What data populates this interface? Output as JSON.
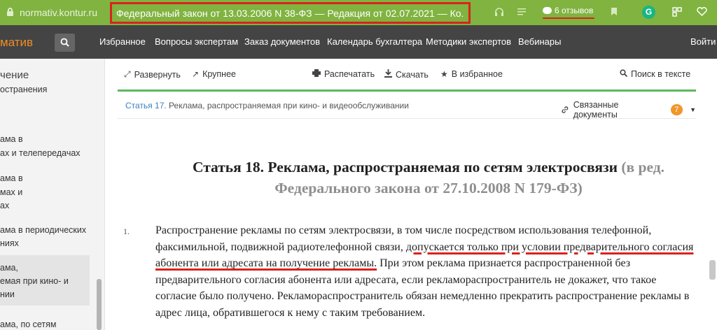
{
  "browser": {
    "url": "normativ.kontur.ru",
    "tab_title": "Федеральный закон от 13.03.2006 N 38-ФЗ — Редакция от 02.07.2021 — Ко...",
    "reviews_label": "6 отзывов",
    "icons": [
      "lock-icon",
      "headphones-icon",
      "reader-icon",
      "bookmark-icon",
      "grammarly-icon",
      "extension-icon",
      "heart-icon"
    ]
  },
  "site": {
    "logo": "матив",
    "nav": [
      "Избранное",
      "Вопросы экспертам",
      "Заказ документов",
      "Календарь бухгалтера",
      "Методики экспертов",
      "Вебинары"
    ],
    "login": "Войти"
  },
  "sidebar": {
    "heading": "чение",
    "items": [
      "остранения",
      "ама в",
      "ах и телепередачах",
      "ама в",
      "мах и",
      "ах",
      "ама в периодических",
      "ниях",
      "ама,",
      "емая при кино- и",
      "нии",
      "ама, по сетям"
    ]
  },
  "toolbar": {
    "expand": "Развернуть",
    "larger": "Крупнее",
    "print": "Распечатать",
    "download": "Скачать",
    "favorite": "В избранное",
    "search": "Поиск в тексте"
  },
  "breadcrumb": {
    "link": "Статья 17.",
    "text": " Реклама, распространяемая при кино- и видеообслуживании"
  },
  "related": {
    "label": "Связанные документы",
    "count": "7"
  },
  "article": {
    "title": "Статья 18. Реклама, распространяемая по сетям электросвязи",
    "edition": "(в ред. Федерального закона от 27.10.2008 N 179-ФЗ)",
    "para_num": "1.",
    "para_before": "Распространение рекламы по сетям электросвязи, в том числе посредством использования телефонной, факсимильной, подвижной радиотелефонной связи, ",
    "para_highlight": "допускается только при условии предварительного согласия абонента или адресата на получение рекламы.",
    "para_after": " При этом реклама признается распространенной без предварительного согласия абонента или адресата, если рекламораспространитель не докажет, что такое согласие было получено. Рекламораспространитель обязан немедленно прекратить распространение рекламы в адрес лица, обратившегося к нему с таким требованием."
  },
  "colors": {
    "browser_bar": "#80b340",
    "site_nav": "#444444",
    "logo": "#f08c26",
    "accent_line": "#5cb85c",
    "highlight_underline": "#d9231d",
    "badge": "#f0962a"
  }
}
